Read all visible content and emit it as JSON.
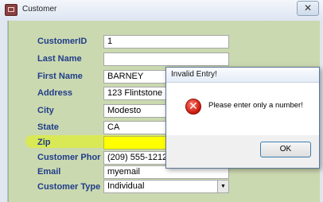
{
  "window": {
    "title": "Customer",
    "close_glyph": "✕"
  },
  "form": {
    "fields": [
      {
        "label": "CustomerID",
        "value": "1"
      },
      {
        "label": "Last Name",
        "value": ""
      },
      {
        "label": "First Name",
        "value": "BARNEY"
      },
      {
        "label": "Address",
        "value": "123 Flintstone"
      },
      {
        "label": "City",
        "value": "Modesto"
      },
      {
        "label": "State",
        "value": "CA"
      },
      {
        "label": "Zip",
        "value": ""
      },
      {
        "label": "Customer  Phor",
        "value": "(209) 555-1212"
      },
      {
        "label": "Email",
        "value": "myemail"
      },
      {
        "label": "Customer  Type",
        "value": "Individual"
      }
    ],
    "dropdown_glyph": "▼"
  },
  "dialog": {
    "title": "Invalid Entry!",
    "icon": "error-icon",
    "icon_glyph": "✕",
    "message": "Please enter only a number!",
    "ok_label": "OK"
  },
  "colors": {
    "form_background": "#cbd9b0",
    "label": "#1f3d8a",
    "zip_highlight": "#dceb46",
    "error": "#c8160b"
  }
}
